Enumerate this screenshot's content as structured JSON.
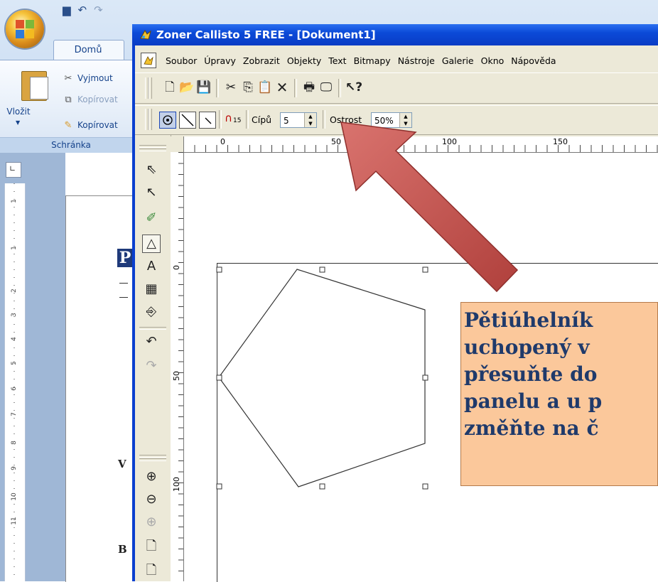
{
  "word": {
    "home_tab": "Domů",
    "paste_label": "Vložit",
    "cut_label": "Vyjmout",
    "copy_label": "Kopírovat",
    "format_painter_label": "Kopírovat",
    "clipboard_group_label": "Schránka",
    "doc_letter_p": "P",
    "doc_letter_v": "V",
    "doc_letter_b": "B",
    "ruler_numbers": [
      "1",
      "1",
      "2",
      "3",
      "4",
      "5",
      "6",
      "7",
      "8",
      "9",
      "10",
      "11"
    ]
  },
  "callisto": {
    "title": "Zoner Callisto 5 FREE - [Dokument1]",
    "menu": [
      "Soubor",
      "Úpravy",
      "Zobrazit",
      "Objekty",
      "Text",
      "Bitmapy",
      "Nástroje",
      "Galerie",
      "Okno",
      "Nápověda"
    ],
    "toolbar2": {
      "tips_label": "Cípů",
      "tips_value": "5",
      "sharpness_label": "Ostrost",
      "sharpness_value": "50%",
      "magnet_label": "15"
    },
    "h_ruler_labels": [
      "0",
      "50",
      "100",
      "150"
    ],
    "v_ruler_labels": [
      "0",
      "50",
      "100"
    ]
  },
  "callout": {
    "text": "Pětiúhelník\nuchopený v\npřesuňte do\npanelu a u p\nzměňte na č"
  },
  "colors": {
    "callout_fill": "#fbc89b",
    "arrow_fill": "#c0504d",
    "titlebar": "#0b4ad8"
  },
  "icons": [
    "office-button-icon",
    "save-icon",
    "undo-icon",
    "new-icon",
    "open-icon",
    "cut-icon",
    "copy-icon",
    "paste-icon",
    "delete-icon",
    "print-icon",
    "preview-icon",
    "help-icon",
    "pointer-icon",
    "node-edit-icon",
    "polygon-icon",
    "text-tool-icon",
    "table-icon",
    "import-icon",
    "zoom-in-icon",
    "zoom-out-icon",
    "magnet-icon"
  ]
}
